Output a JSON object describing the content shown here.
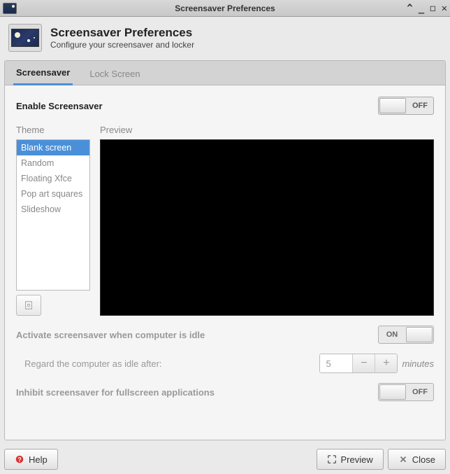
{
  "window": {
    "title": "Screensaver Preferences"
  },
  "header": {
    "title": "Screensaver Preferences",
    "subtitle": "Configure your screensaver and locker"
  },
  "tabs": [
    {
      "label": "Screensaver",
      "active": true
    },
    {
      "label": "Lock Screen",
      "active": false
    }
  ],
  "enable": {
    "label": "Enable Screensaver",
    "state": "OFF"
  },
  "theme": {
    "label": "Theme",
    "items": [
      "Blank screen",
      "Random",
      "Floating Xfce",
      "Pop art squares",
      "Slideshow"
    ],
    "selected": 0
  },
  "preview": {
    "label": "Preview"
  },
  "activate": {
    "label": "Activate screensaver when computer is idle",
    "state": "ON"
  },
  "idle": {
    "label": "Regard the computer as idle after:",
    "value": "5",
    "unit": "minutes"
  },
  "inhibit": {
    "label": "Inhibit screensaver for fullscreen applications",
    "state": "OFF"
  },
  "footer": {
    "help": "Help",
    "preview": "Preview",
    "close": "Close"
  }
}
